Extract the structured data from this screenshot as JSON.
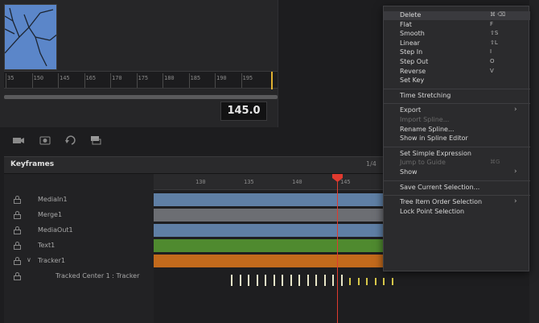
{
  "viewer": {
    "ruler_ticks": [
      "35",
      "150",
      "145",
      "165",
      "170",
      "175",
      "180",
      "185",
      "190",
      "195"
    ],
    "time": "145.0"
  },
  "keyframes": {
    "title": "Keyframes",
    "options": [
      "1/4"
    ],
    "tracks": [
      {
        "name": "MediaIn1"
      },
      {
        "name": "Merge1"
      },
      {
        "name": "MediaOut1"
      },
      {
        "name": "Text1"
      },
      {
        "name": "Tracker1",
        "expanded": true
      },
      {
        "name": "Tracked Center 1 : Tracker"
      }
    ],
    "timeline_ticks": [
      "130",
      "135",
      "140",
      "145"
    ],
    "colors": {
      "mediain": "#5f7fa5",
      "merge": "#6c6e73",
      "mediaout": "#5f7fa5",
      "text": "#4f8a2f",
      "tracker": "#c26a1c",
      "playhead": "#e03a2f"
    }
  },
  "context_menu": {
    "items": [
      {
        "label": "Delete",
        "shortcut": "⌘ ⌫",
        "highlighted": true
      },
      {
        "label": "Flat",
        "shortcut": "F"
      },
      {
        "label": "Smooth",
        "shortcut": "⇧S"
      },
      {
        "label": "Linear",
        "shortcut": "⇧L"
      },
      {
        "label": "Step In",
        "shortcut": "I"
      },
      {
        "label": "Step Out",
        "shortcut": "O"
      },
      {
        "label": "Reverse",
        "shortcut": "V"
      },
      {
        "label": "Set Key"
      },
      {
        "sep": true
      },
      {
        "label": "Time Stretching"
      },
      {
        "sep": true
      },
      {
        "label": "Export",
        "submenu": true
      },
      {
        "label": "Import Spline...",
        "disabled": true
      },
      {
        "label": "Rename Spline..."
      },
      {
        "label": "Show in Spline Editor"
      },
      {
        "sep": true
      },
      {
        "label": "Set Simple Expression"
      },
      {
        "label": "Jump to Guide",
        "shortcut": "⌘G",
        "disabled": true
      },
      {
        "label": "Show",
        "submenu": true
      },
      {
        "sep": true
      },
      {
        "label": "Save Current Selection..."
      },
      {
        "sep": true
      },
      {
        "label": "Tree Item Order Selection",
        "submenu": true
      },
      {
        "label": "Lock Point Selection"
      }
    ]
  }
}
